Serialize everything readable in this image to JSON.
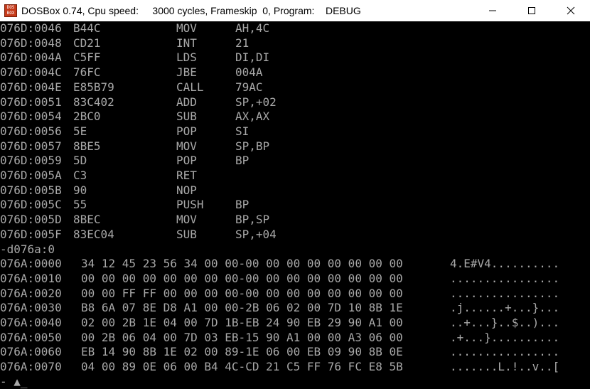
{
  "window": {
    "title": "DOSBox 0.74, Cpu speed:     3000 cycles, Frameskip  0, Program:    DEBUG",
    "icon_text_top": "DOS",
    "icon_text_bottom": "BOX",
    "icon": "dosbox-icon"
  },
  "disassembly": [
    {
      "addr": "076D:0046",
      "bytes": "B44C",
      "mnemonic": "MOV",
      "operands": "AH,4C"
    },
    {
      "addr": "076D:0048",
      "bytes": "CD21",
      "mnemonic": "INT",
      "operands": "21"
    },
    {
      "addr": "076D:004A",
      "bytes": "C5FF",
      "mnemonic": "LDS",
      "operands": "DI,DI"
    },
    {
      "addr": "076D:004C",
      "bytes": "76FC",
      "mnemonic": "JBE",
      "operands": "004A"
    },
    {
      "addr": "076D:004E",
      "bytes": "E85B79",
      "mnemonic": "CALL",
      "operands": "79AC"
    },
    {
      "addr": "076D:0051",
      "bytes": "83C402",
      "mnemonic": "ADD",
      "operands": "SP,+02"
    },
    {
      "addr": "076D:0054",
      "bytes": "2BC0",
      "mnemonic": "SUB",
      "operands": "AX,AX"
    },
    {
      "addr": "076D:0056",
      "bytes": "5E",
      "mnemonic": "POP",
      "operands": "SI"
    },
    {
      "addr": "076D:0057",
      "bytes": "8BE5",
      "mnemonic": "MOV",
      "operands": "SP,BP"
    },
    {
      "addr": "076D:0059",
      "bytes": "5D",
      "mnemonic": "POP",
      "operands": "BP"
    },
    {
      "addr": "076D:005A",
      "bytes": "C3",
      "mnemonic": "RET",
      "operands": ""
    },
    {
      "addr": "076D:005B",
      "bytes": "90",
      "mnemonic": "NOP",
      "operands": ""
    },
    {
      "addr": "076D:005C",
      "bytes": "55",
      "mnemonic": "PUSH",
      "operands": "BP"
    },
    {
      "addr": "076D:005D",
      "bytes": "8BEC",
      "mnemonic": "MOV",
      "operands": "BP,SP"
    },
    {
      "addr": "076D:005F",
      "bytes": "83EC04",
      "mnemonic": "SUB",
      "operands": "SP,+04"
    }
  ],
  "command": "-d076a:0",
  "dump": [
    {
      "addr": "076A:0000",
      "hex": "34 12 45 23 56 34 00 00-00 00 00 00 00 00 00 00",
      "ascii": "4.E#V4.........."
    },
    {
      "addr": "076A:0010",
      "hex": "00 00 00 00 00 00 00 00-00 00 00 00 00 00 00 00",
      "ascii": "................"
    },
    {
      "addr": "076A:0020",
      "hex": "00 00 FF FF 00 00 00 00-00 00 00 00 00 00 00 00",
      "ascii": "................"
    },
    {
      "addr": "076A:0030",
      "hex": "B8 6A 07 8E D8 A1 00 00-2B 06 02 00 7D 10 8B 1E",
      "ascii": ".j......+...}..."
    },
    {
      "addr": "076A:0040",
      "hex": "02 00 2B 1E 04 00 7D 1B-EB 24 90 EB 29 90 A1 00",
      "ascii": "..+...}..$..)..."
    },
    {
      "addr": "076A:0050",
      "hex": "00 2B 06 04 00 7D 03 EB-15 90 A1 00 00 A3 06 00",
      "ascii": ".+...}.........."
    },
    {
      "addr": "076A:0060",
      "hex": "EB 14 90 8B 1E 02 00 89-1E 06 00 EB 09 90 8B 0E",
      "ascii": "................"
    },
    {
      "addr": "076A:0070",
      "hex": "04 00 89 0E 06 00 B4 4C-CD 21 C5 FF 76 FC E8 5B",
      "ascii": ".......L.!..v..["
    }
  ],
  "prompt": "- ▲_"
}
